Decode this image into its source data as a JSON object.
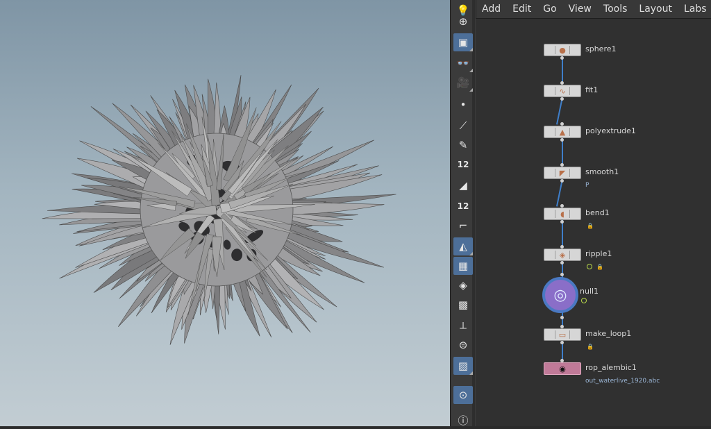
{
  "menubar": {
    "items": [
      "Add",
      "Edit",
      "Go",
      "View",
      "Tools",
      "Layout",
      "Labs"
    ]
  },
  "shelf": {
    "tools": [
      {
        "name": "light-bulb-icon"
      },
      {
        "name": "add-light-icon"
      },
      {
        "name": "camera-view-icon"
      },
      {
        "name": "display-options-icon"
      },
      {
        "name": "render-view-icon"
      },
      {
        "name": "point-tool-icon"
      },
      {
        "name": "edge-tool-icon"
      },
      {
        "name": "brush-tool-icon"
      },
      {
        "name": "snap-points-icon",
        "label": "12"
      },
      {
        "name": "select-tool-icon"
      },
      {
        "name": "snap-grid-icon",
        "label": "12"
      },
      {
        "name": "curve-tool-icon"
      },
      {
        "name": "shaded-mode-icon"
      },
      {
        "name": "checker-icon"
      },
      {
        "name": "diamond-icon"
      },
      {
        "name": "uv-icon"
      },
      {
        "name": "transform-handle-icon"
      },
      {
        "name": "wireframe-icon"
      },
      {
        "name": "background-image-icon"
      },
      {
        "name": "pin-icon"
      },
      {
        "name": "info-icon"
      }
    ]
  },
  "nodes": [
    {
      "label": "sphere1",
      "icon": "sphere-icon"
    },
    {
      "label": "fit1",
      "icon": "curve-icon"
    },
    {
      "label": "polyextrude1",
      "icon": "extrude-icon"
    },
    {
      "label": "smooth1",
      "icon": "smooth-icon",
      "sub": "P"
    },
    {
      "label": "bend1",
      "icon": "bend-icon"
    },
    {
      "label": "ripple1",
      "icon": "ripple-icon"
    },
    {
      "label": "null1",
      "icon": "null-icon"
    },
    {
      "label": "make_loop1",
      "icon": "loop-icon"
    },
    {
      "label": "rop_alembic1",
      "icon": "alembic-icon",
      "sub": "out_waterlive_1920.abc"
    }
  ],
  "colors": {
    "wire": "#3e7ec9",
    "selected_node": "#4a79c2",
    "rop_node": "#c07a98",
    "display_flag": "#b9d94a"
  }
}
